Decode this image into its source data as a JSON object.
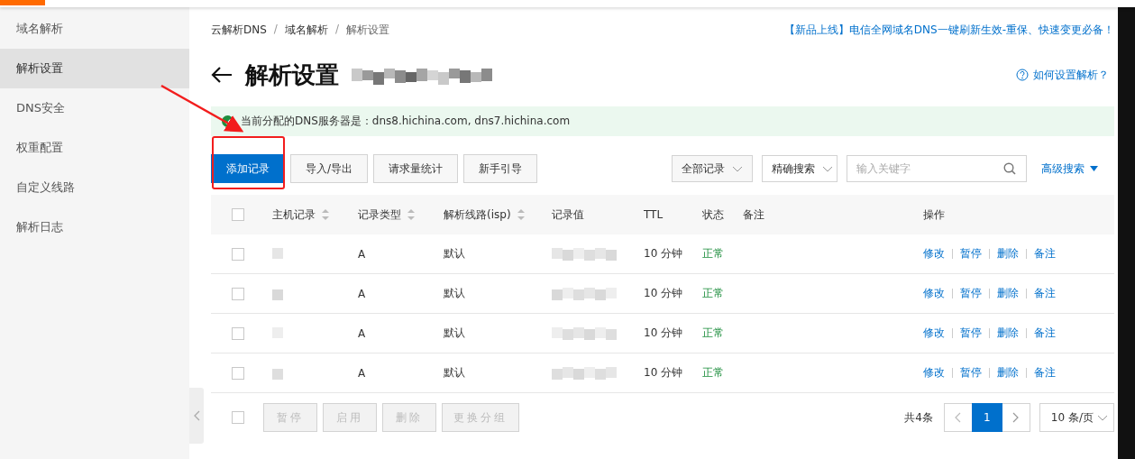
{
  "sidebar": {
    "items": [
      {
        "label": "域名解析",
        "selected": false
      },
      {
        "label": "解析设置",
        "selected": true
      },
      {
        "label": "DNS安全",
        "selected": false
      },
      {
        "label": "权重配置",
        "selected": false
      },
      {
        "label": "自定义线路",
        "selected": false
      },
      {
        "label": "解析日志",
        "selected": false
      }
    ]
  },
  "breadcrumb": [
    {
      "kind": "link",
      "label": "云解析DNS"
    },
    {
      "kind": "separator",
      "label": "/"
    },
    {
      "kind": "link",
      "label": "域名解析"
    },
    {
      "kind": "separator",
      "label": "/"
    },
    {
      "kind": "current",
      "label": "解析设置"
    }
  ],
  "promo": "【新品上线】电信全网域名DNS一键刷新生效-重保、快速变更必备！",
  "page_title": "解析设置",
  "help_link": "如何设置解析？",
  "notice": "当前分配的DNS服务器是：dns8.hichina.com, dns7.hichina.com",
  "toolbar": {
    "buttons": [
      {
        "label": "添加记录",
        "kind": "primary"
      },
      {
        "label": "导入/导出",
        "kind": "default"
      },
      {
        "label": "请求量统计",
        "kind": "default"
      },
      {
        "label": "新手引导",
        "kind": "default"
      }
    ],
    "filter": "全部记录",
    "search_mode": "精确搜索",
    "search": {
      "placeholder": "输入关键字"
    },
    "advanced": "高级搜索"
  },
  "table": {
    "select_all": {
      "checked": false
    },
    "columns": [
      {
        "label": "主机记录",
        "sortable": true
      },
      {
        "label": "记录类型",
        "sortable": true
      },
      {
        "label": "解析线路(isp)",
        "sortable": true
      },
      {
        "label": "记录值",
        "sortable": false
      },
      {
        "label": "TTL",
        "sortable": false
      },
      {
        "label": "状态",
        "sortable": false
      },
      {
        "label": "备注",
        "sortable": false
      },
      {
        "label": "操作",
        "sortable": false
      }
    ],
    "rows": [
      {
        "checked": false,
        "type": "A",
        "line": "默认",
        "ttl": "10 分钟",
        "status": "正常",
        "actions": [
          "修改",
          "暂停",
          "删除",
          "备注"
        ]
      },
      {
        "checked": false,
        "type": "A",
        "line": "默认",
        "ttl": "10 分钟",
        "status": "正常",
        "actions": [
          "修改",
          "暂停",
          "删除",
          "备注"
        ]
      },
      {
        "checked": false,
        "type": "A",
        "line": "默认",
        "ttl": "10 分钟",
        "status": "正常",
        "actions": [
          "修改",
          "暂停",
          "删除",
          "备注"
        ]
      },
      {
        "checked": false,
        "type": "A",
        "line": "默认",
        "ttl": "10 分钟",
        "status": "正常",
        "actions": [
          "修改",
          "暂停",
          "删除",
          "备注"
        ]
      }
    ]
  },
  "bulk": {
    "checked": false,
    "buttons": [
      {
        "label": "暂停",
        "disabled": true
      },
      {
        "label": "启用",
        "disabled": true
      },
      {
        "label": "删除",
        "disabled": true
      },
      {
        "label": "更换分组",
        "disabled": true
      }
    ]
  },
  "pagination": {
    "total": "共4条",
    "pages": [
      {
        "label": "1",
        "selected": true
      }
    ],
    "page_size": "10 条/页"
  }
}
